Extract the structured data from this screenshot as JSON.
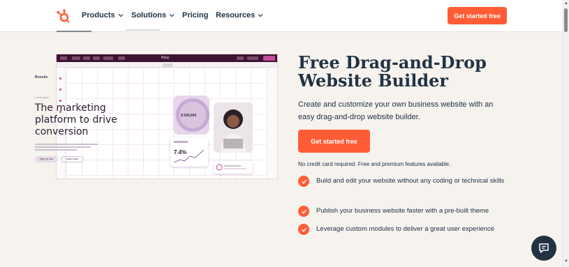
{
  "nav": {
    "items": [
      {
        "label": "Products",
        "has_dropdown": true
      },
      {
        "label": "Solutions",
        "has_dropdown": true
      },
      {
        "label": "Pricing",
        "has_dropdown": false
      },
      {
        "label": "Resources",
        "has_dropdown": true
      }
    ],
    "cta_label": "Get started free",
    "logo_icon": "hubspot-sprocket-icon"
  },
  "mockup": {
    "brand": "Bonsite",
    "tagline": "Lorem ipsum",
    "headline": "The marketing platform to drive conversion",
    "primary_button": "Sign up now",
    "secondary_button": "Learn more",
    "ring_value": "$ 500,000",
    "stat_value": "7.4%",
    "toolbar_title": "Bday"
  },
  "hero": {
    "headline": "Free Drag-and-Drop Website Builder",
    "description": "Create and customize your own business website with an easy drag-and-drop website builder.",
    "cta_label": "Get started free",
    "note": "No credit card required. Free and premium features available.",
    "features": [
      "Build and edit your website without any coding or technical skills",
      "Publish your business website faster with a pre-built theme",
      "Leverage custom modules to deliver a great user experience"
    ]
  },
  "colors": {
    "accent": "#ff5c35",
    "text": "#213343",
    "background": "#f6f2ee"
  },
  "chat_icon": "chat-bubble-icon"
}
